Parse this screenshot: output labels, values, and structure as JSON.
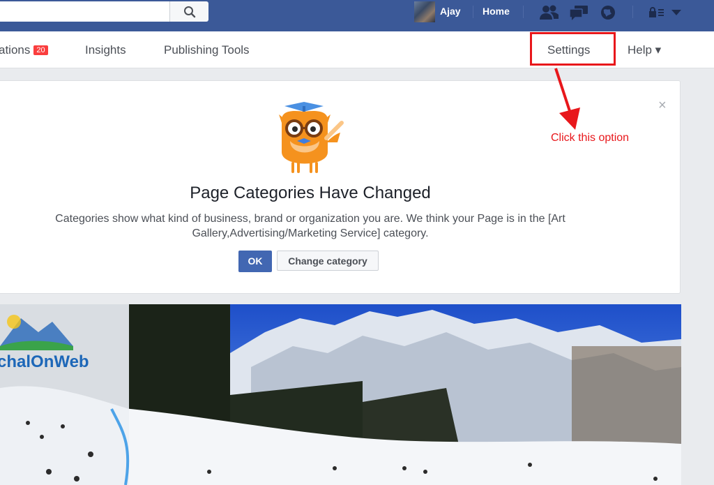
{
  "topbar": {
    "user_name": "Ajay",
    "home_label": "Home",
    "icons": [
      "search-icon",
      "friend-requests-icon",
      "messages-icon",
      "notifications-icon",
      "privacy-shortcuts-icon",
      "account-menu-icon"
    ]
  },
  "subnav": {
    "notifications_label": "ations",
    "notifications_badge": "20",
    "insights_label": "Insights",
    "publishing_tools_label": "Publishing Tools",
    "settings_label": "Settings",
    "help_label": "Help ▾"
  },
  "annotation": {
    "text": "Click this option",
    "color": "#e8171b"
  },
  "card": {
    "close_glyph": "×",
    "title": "Page Categories Have Changed",
    "line1": "Categories show what kind of business, brand or organization you are. We think your Page is in the [Art",
    "line2": "Gallery,Advertising/Marketing Service] category.",
    "ok_label": "OK",
    "change_label": "Change category"
  },
  "cover": {
    "logo_text": "chalOnWeb"
  },
  "colors": {
    "brand_blue": "#3b5998",
    "button_blue": "#4267b2",
    "badge_red": "#fa3e3e",
    "highlight_red": "#e8171b"
  }
}
